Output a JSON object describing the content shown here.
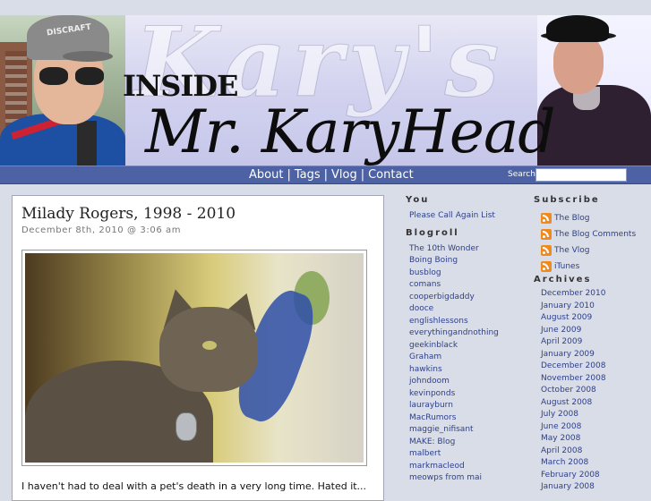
{
  "header": {
    "bg_script": "Kary's",
    "inside_text": "INSIDE",
    "title": "Mr. KaryHead",
    "cap_text": "DISCRAFT"
  },
  "nav": {
    "items": [
      "About",
      "Tags",
      "Vlog",
      "Contact"
    ],
    "separator": "|",
    "search_label": "Search:",
    "search_value": ""
  },
  "post": {
    "title": "Milady Rogers, 1998 - 2010",
    "date": "December 8th, 2010 @ 3:06 am",
    "text": "I haven't had to deal with a pet's death in a very long time. Hated it..."
  },
  "sidebar_left": {
    "you_heading": "You",
    "you_items": [
      "Please Call Again List"
    ],
    "blogroll_heading": "Blogroll",
    "blogroll_items": [
      "The 10th Wonder",
      "Boing Boing",
      "busblog",
      "comans",
      "cooperbigdaddy",
      "dooce",
      "englishlessons",
      "everythingandnothing",
      "geekinblack",
      "Graham",
      "hawkins",
      "johndoom",
      "kevinponds",
      "laurayburn",
      "MacRumors",
      "maggie_nifisant",
      "MAKE: Blog",
      "malbert",
      "markmacleod",
      "meowps from mai"
    ]
  },
  "sidebar_right": {
    "subscribe_heading": "Subscribe",
    "feeds": [
      "The Blog",
      "The Blog Comments",
      "The Vlog",
      "iTunes"
    ],
    "archives_heading": "Archives",
    "archives": [
      "December 2010",
      "January 2010",
      "August 2009",
      "June 2009",
      "April 2009",
      "January 2009",
      "December 2008",
      "November 2008",
      "October 2008",
      "August 2008",
      "July 2008",
      "June 2008",
      "May 2008",
      "April 2008",
      "March 2008",
      "February 2008",
      "January 2008"
    ]
  },
  "colors": {
    "nav_bg": "#4c62a4",
    "link": "#2d3f8a",
    "page_bg": "#d9dde8",
    "rss": "#f08a1d"
  }
}
